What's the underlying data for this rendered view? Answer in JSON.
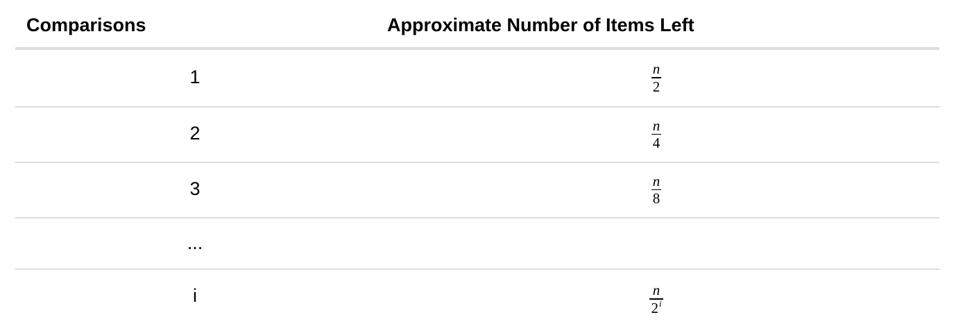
{
  "table": {
    "headers": [
      "Comparisons",
      "Approximate Number of Items Left"
    ],
    "rows": [
      {
        "comparisons": "1",
        "numerator": "n",
        "denominator": "2",
        "exponent": ""
      },
      {
        "comparisons": "2",
        "numerator": "n",
        "denominator": "4",
        "exponent": ""
      },
      {
        "comparisons": "3",
        "numerator": "n",
        "denominator": "8",
        "exponent": ""
      },
      {
        "comparisons": "...",
        "numerator": "",
        "denominator": "",
        "exponent": ""
      },
      {
        "comparisons": "i",
        "numerator": "n",
        "denominator": "2",
        "exponent": "i"
      }
    ]
  }
}
